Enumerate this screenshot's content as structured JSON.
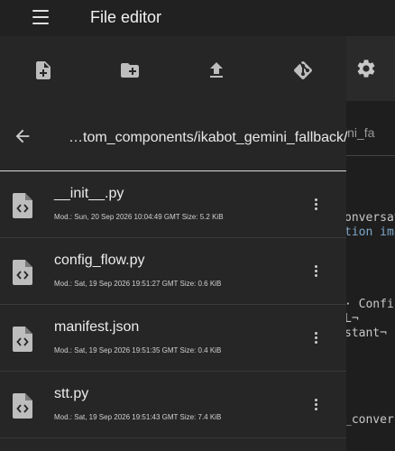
{
  "header": {
    "title": "File editor",
    "menu_icon": "menu-icon"
  },
  "editor": {
    "settings_icon": "gear-icon",
    "filename_fragment": "ini_fa",
    "code_lines": [
      {
        "text": "onversat",
        "color": "#c8c8c8"
      },
      {
        "text": "tion imp",
        "color": "#7fa8c9"
      },
      {
        "text": "· Confi",
        "color": "#c8c8c8"
      },
      {
        "text": "L¬",
        "color": "#c8c8c8"
      },
      {
        "text": "stant¬",
        "color": "#c8c8c8"
      },
      {
        "text": "_conver",
        "color": "#c8c8c8"
      }
    ]
  },
  "drawer": {
    "toolbar": [
      {
        "name": "new-file-button",
        "icon": "file-plus-icon"
      },
      {
        "name": "new-folder-button",
        "icon": "folder-plus-icon"
      },
      {
        "name": "upload-button",
        "icon": "upload-icon"
      },
      {
        "name": "git-button",
        "icon": "git-icon"
      }
    ],
    "back_icon": "arrow-left-icon",
    "path": "…tom_components/ikabot_gemini_fallback/",
    "files": [
      {
        "name": "__init__.py",
        "meta": "Mod.: Sun, 20 Sep 2026 10:04:49 GMT  Size: 5.2 KiB"
      },
      {
        "name": "config_flow.py",
        "meta": "Mod.: Sat, 19 Sep 2026 19:51:27 GMT  Size: 0.6 KiB"
      },
      {
        "name": "manifest.json",
        "meta": "Mod.: Sat, 19 Sep 2026 19:51:35 GMT  Size: 0.4 KiB"
      },
      {
        "name": "stt.py",
        "meta": "Mod.: Sat, 19 Sep 2026 19:51:43 GMT  Size: 7.4 KiB"
      }
    ]
  },
  "colors": {
    "drawer_bg": "#262626",
    "topbar_bg": "#212121",
    "icon": "#bdbdbd"
  }
}
